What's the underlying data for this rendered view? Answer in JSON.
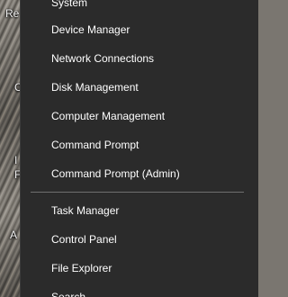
{
  "desktop": {
    "fragments": [
      "Re",
      "C",
      "I",
      "F",
      "A"
    ]
  },
  "menu": {
    "group1": [
      "System",
      "Device Manager",
      "Network Connections",
      "Disk Management",
      "Computer Management",
      "Command Prompt",
      "Command Prompt (Admin)"
    ],
    "group2": [
      "Task Manager",
      "Control Panel",
      "File Explorer",
      "Search"
    ]
  },
  "colors": {
    "menu_background": "#2b2b2b",
    "menu_text": "#ffffff",
    "separator": "#6f6f6f"
  }
}
